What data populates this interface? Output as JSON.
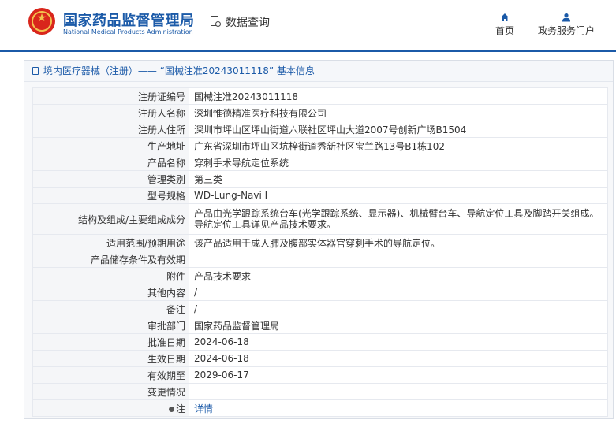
{
  "header": {
    "site_name_cn": "国家药品监督管理局",
    "site_name_en": "National Medical Products Administration",
    "data_query_label": "数据查询",
    "nav": [
      {
        "label": "首页",
        "icon": "home-icon"
      },
      {
        "label": "政务服务门户",
        "icon": "user-icon"
      }
    ]
  },
  "breadcrumb": {
    "text": "境内医疗器械（注册）——  “国械注准20243011118” 基本信息"
  },
  "record": [
    {
      "label": "注册证编号",
      "value": "国械注准20243011118"
    },
    {
      "label": "注册人名称",
      "value": "深圳惟德精准医疗科技有限公司"
    },
    {
      "label": "注册人住所",
      "value": "深圳市坪山区坪山街道六联社区坪山大道2007号创新广场B1504"
    },
    {
      "label": "生产地址",
      "value": "广东省深圳市坪山区坑梓街道秀新社区宝兰路13号B1栋102"
    },
    {
      "label": "产品名称",
      "value": "穿刺手术导航定位系统"
    },
    {
      "label": "管理类别",
      "value": "第三类"
    },
    {
      "label": "型号规格",
      "value": "WD-Lung-Navi I"
    },
    {
      "label": "结构及组成/主要组成成分",
      "value": "产品由光学跟踪系统台车(光学跟踪系统、显示器)、机械臂台车、导航定位工具及脚踏开关组成。导航定位工具详见产品技术要求。"
    },
    {
      "label": "适用范围/预期用途",
      "value": "该产品适用于成人肺及腹部实体器官穿刺手术的导航定位。"
    },
    {
      "label": "产品储存条件及有效期",
      "value": ""
    },
    {
      "label": "附件",
      "value": "产品技术要求"
    },
    {
      "label": "其他内容",
      "value": "/"
    },
    {
      "label": "备注",
      "value": "/"
    },
    {
      "label": "审批部门",
      "value": "国家药品监督管理局"
    },
    {
      "label": "批准日期",
      "value": "2024-06-18"
    },
    {
      "label": "生效日期",
      "value": "2024-06-18"
    },
    {
      "label": "有效期至",
      "value": "2029-06-17"
    },
    {
      "label": "变更情况",
      "value": ""
    }
  ],
  "note": {
    "label": "注",
    "link_text": "详情"
  }
}
